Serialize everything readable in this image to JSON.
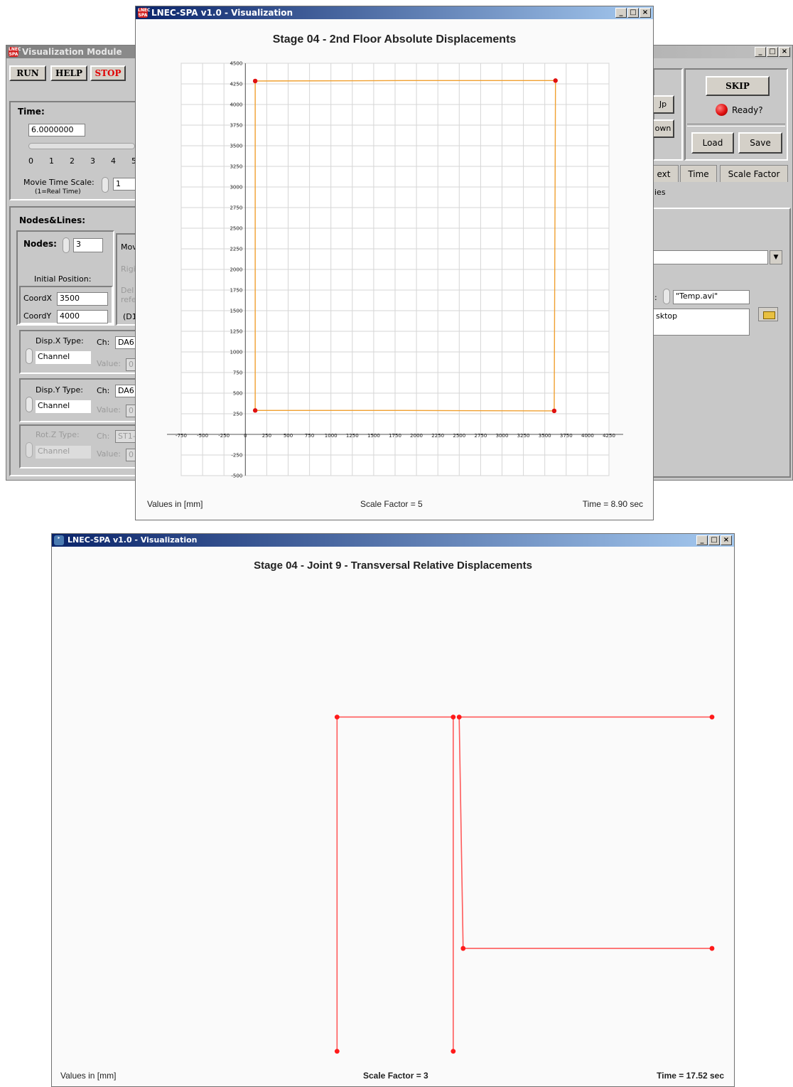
{
  "viz_module": {
    "title": "Visualization Module",
    "run_label": "RUN",
    "help_label": "HELP",
    "stop_label": "STOP",
    "time_label": "Time:",
    "time_value": "6.0000000",
    "time_ticks": [
      "0",
      "1",
      "2",
      "3",
      "4",
      "5"
    ],
    "movie_time_scale_label": "Movie Time Scale:",
    "movie_time_scale_note": "(1=Real Time)",
    "movie_time_scale_value": "1",
    "nodes_lines_label": "Nodes&Lines:",
    "nodes_label": "Nodes:",
    "nodes_value": "3",
    "initial_position_label": "Initial Position:",
    "coordx_label": "CoordX",
    "coordx_value": "3500",
    "coordy_label": "CoordY",
    "coordy_value": "4000",
    "mov_label": "Mov",
    "rig_label": "Rigi",
    "del_label": "Del",
    "ref_label": "refe",
    "d1_label": "(D1",
    "dispx_label": "Disp.X Type:",
    "dispx_value": "Channel",
    "dispy_label": "Disp.Y Type:",
    "dispy_value": "Channel",
    "rotz_label": "Rot.Z Type:",
    "rotz_value": "Channel",
    "ch_label": "Ch:",
    "ch_dispx": "DA6",
    "ch_dispy": "DA6",
    "ch_rotz": "ST1-",
    "value_label": "Value:",
    "value_val": "0",
    "up_label": "Jp",
    "down_label": "own",
    "skip_label": "SKIP",
    "ready_label": "Ready?",
    "load_label": "Load",
    "save_label": "Save",
    "tabs": [
      "ext",
      "Time",
      "Scale Factor"
    ],
    "ies_label": "ies",
    "avi_prefix": ":",
    "avi_name": "\"Temp.avi\"",
    "path_value": "sktop",
    "colors": {
      "led": "#e01010",
      "stop_text": "#e00000"
    }
  },
  "plot1": {
    "window_title": "LNEC-SPA v1.0 - Visualization",
    "footer_left": "Values in [mm]",
    "footer_center": "Scale Factor = 5",
    "footer_right": "Time = 8.90 sec"
  },
  "plot2": {
    "window_title": "LNEC-SPA v1.0 - Visualization",
    "footer_left": "Values in [mm]",
    "footer_center": "Scale Factor = 3",
    "footer_right": "Time = 17.52 sec"
  },
  "chart_data": [
    {
      "type": "line",
      "title": "Stage 04 - 2nd Floor Absolute Displacements",
      "xlabel": "",
      "ylabel": "",
      "xlim": [
        -750,
        4250
      ],
      "ylim": [
        -500,
        4500
      ],
      "grid": true,
      "x_ticks": [
        -750,
        -500,
        -250,
        0,
        250,
        500,
        750,
        1000,
        1250,
        1500,
        1750,
        2000,
        2250,
        2500,
        2750,
        3000,
        3250,
        3500,
        3750,
        4000,
        4250
      ],
      "y_ticks": [
        -500,
        -250,
        0,
        250,
        500,
        750,
        1000,
        1250,
        1500,
        1750,
        2000,
        2250,
        2500,
        2750,
        3000,
        3250,
        3500,
        3750,
        4000,
        4250,
        4500
      ],
      "line_color": "#f0a030",
      "point_color": "#e01010",
      "series": [
        {
          "x": [
            115,
            1870,
            3625,
            3610,
            1870,
            115,
            115
          ],
          "y": [
            4285,
            4290,
            4290,
            285,
            290,
            290,
            4285
          ],
          "points": [
            [
              115,
              4285
            ],
            [
              3625,
              4290
            ],
            [
              3610,
              285
            ],
            [
              115,
              290
            ]
          ]
        }
      ]
    },
    {
      "type": "line",
      "title": "Stage 04 - Joint 9 - Transversal Relative Displacements",
      "xlabel": "",
      "ylabel": "",
      "grid": false,
      "xlim": [
        0,
        1000
      ],
      "ylim": [
        0,
        1000
      ],
      "line_color": "#ff5a5a",
      "point_color": "#ff1a1a",
      "series": [
        {
          "x": [
            432,
            432,
            608
          ],
          "y": [
            67,
            720,
            720
          ]
        },
        {
          "x": [
            608,
            608
          ],
          "y": [
            720,
            67
          ]
        },
        {
          "x": [
            617,
            623,
            1000
          ],
          "y": [
            720,
            268,
            268
          ]
        },
        {
          "x": [
            617,
            1000
          ],
          "y": [
            720,
            720
          ]
        }
      ],
      "points": [
        [
          432,
          67
        ],
        [
          432,
          720
        ],
        [
          608,
          720
        ],
        [
          608,
          67
        ],
        [
          617,
          720
        ],
        [
          623,
          268
        ],
        [
          1000,
          268
        ],
        [
          1000,
          720
        ]
      ]
    }
  ]
}
